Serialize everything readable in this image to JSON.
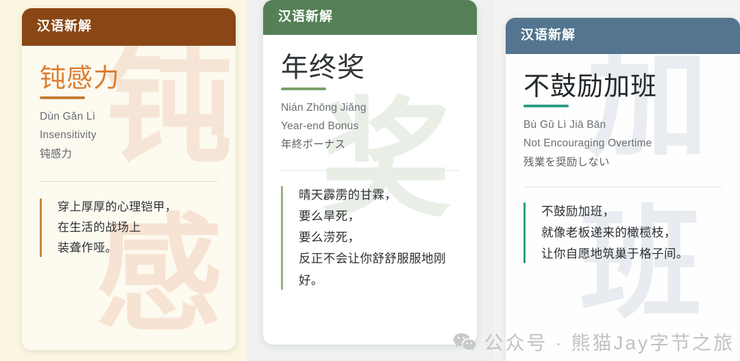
{
  "cards": [
    {
      "header_label": "汉语新解",
      "header_color": "#8a4715",
      "accent_color": "#c67a32",
      "title": "钝感力",
      "title_color": "#dd7e2f",
      "pinyin": "Dùn Gǎn Lì",
      "english": "Insensitivity",
      "japanese": "钝感力",
      "watermark_top": "钝",
      "watermark_bottom": "感",
      "quote_lines": [
        "穿上厚厚的心理铠甲，",
        "在生活的战场上",
        "装聋作哑。"
      ]
    },
    {
      "header_label": "汉语新解",
      "header_color": "#558055",
      "accent_color": "#7b9f6a",
      "title": "年终奖",
      "title_color": "#2f3437",
      "pinyin": "Nián Zhōng Jiǎng",
      "english": "Year-end Bonus",
      "japanese": "年終ボーナス",
      "watermark_top": "奖",
      "watermark_bottom": "",
      "quote_lines": [
        "晴天霹雳的甘霖，",
        "要么旱死，",
        "要么涝死，",
        "反正不会让你舒舒服服地刚",
        "好。"
      ]
    },
    {
      "header_label": "汉语新解",
      "header_color": "#53758f",
      "accent_color": "#2e9c84",
      "title": "不鼓励加班",
      "title_color": "#23282c",
      "pinyin": "Bù Gǔ Lì Jiā Bān",
      "english": "Not Encouraging Overtime",
      "japanese": "残業を奨励しない",
      "watermark_top": "加",
      "watermark_bottom": "班",
      "quote_lines": [
        "不鼓励加班，",
        "就像老板递来的橄榄枝，",
        "让你自愿地筑巢于格子间。"
      ]
    }
  ],
  "watermark": {
    "icon": "wechat-icon",
    "text": "公众号 · 熊猫Jay字节之旅"
  }
}
